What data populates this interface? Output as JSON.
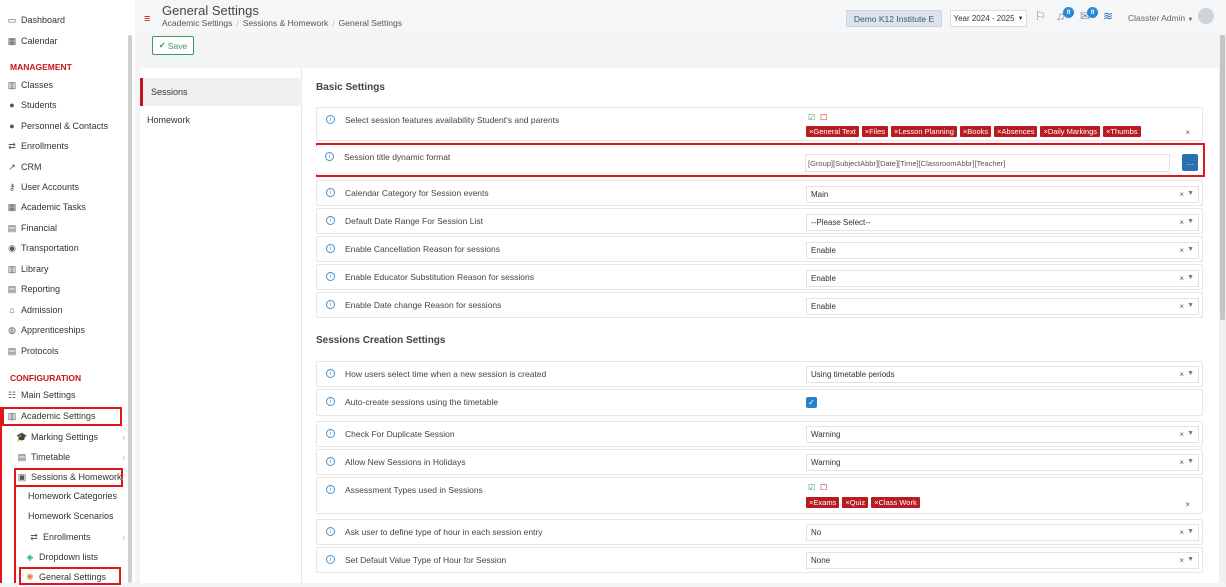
{
  "sidebar": {
    "items": [
      {
        "label": "Dashboard",
        "icon": "monitor-icon"
      },
      {
        "label": "Calendar",
        "icon": "calendar-icon"
      }
    ],
    "management_heading": "MANAGEMENT",
    "management": [
      {
        "label": "Classes",
        "icon": "classes-icon"
      },
      {
        "label": "Students",
        "icon": "students-icon"
      },
      {
        "label": "Personnel & Contacts",
        "icon": "person-icon"
      },
      {
        "label": "Enrollments",
        "icon": "exchange-icon"
      },
      {
        "label": "CRM",
        "icon": "crm-icon"
      },
      {
        "label": "User Accounts",
        "icon": "key-icon"
      },
      {
        "label": "Academic Tasks",
        "icon": "grid-icon"
      },
      {
        "label": "Financial",
        "icon": "money-icon"
      },
      {
        "label": "Transportation",
        "icon": "bus-icon"
      },
      {
        "label": "Library",
        "icon": "books-icon"
      },
      {
        "label": "Reporting",
        "icon": "report-icon"
      },
      {
        "label": "Admission",
        "icon": "bank-icon"
      },
      {
        "label": "Apprenticeships",
        "icon": "apprentice-icon"
      },
      {
        "label": "Protocols",
        "icon": "protocol-icon"
      }
    ],
    "configuration_heading": "CONFIGURATION",
    "configuration": [
      {
        "label": "Main Settings",
        "icon": "sliders-icon"
      },
      {
        "label": "Academic Settings",
        "icon": "classes-icon"
      }
    ],
    "academic_sub": [
      {
        "label": "Marking Settings",
        "icon": "graduation-icon"
      },
      {
        "label": "Timetable",
        "icon": "timetable-icon"
      },
      {
        "label": "Sessions & Homework",
        "icon": "sessions-icon"
      }
    ],
    "sessions_sub": [
      {
        "label": "Homework Categories"
      },
      {
        "label": "Homework Scenarios"
      },
      {
        "label": "Enrollments",
        "icon": "exchange-icon"
      },
      {
        "label": "Dropdown lists",
        "icon": "layers-icon"
      },
      {
        "label": "General Settings",
        "icon": "cog-icon"
      }
    ]
  },
  "header": {
    "title": "General Settings",
    "breadcrumb": [
      "Academic Settings",
      "Sessions & Homework",
      "General Settings"
    ],
    "institute": "Demo K12 Institute E",
    "year": "Year 2024 - 2025",
    "notif_count": "0",
    "msg_count": "0",
    "user": "Classter Admin"
  },
  "toolbar": {
    "save_label": "Save"
  },
  "leftnav": {
    "items": [
      "Sessions",
      "Homework"
    ]
  },
  "basic": {
    "title": "Basic Settings",
    "features_label": "Select session features availability Student's and parents",
    "features_tags": [
      "General Text",
      "Files",
      "Lesson Planning",
      "Books",
      "Absences",
      "Daily Markings",
      "Thumbs"
    ],
    "title_format_label": "Session title dynamic format",
    "title_format_value": "[Group][SubjectAbbr][Date][Time][ClassroomAbbr][Teacher]",
    "dots": "...",
    "rows": [
      {
        "label": "Calendar Category for Session events",
        "value": "Main"
      },
      {
        "label": "Default Date Range For Session List",
        "value": "--Please Select--"
      },
      {
        "label": "Enable Cancellation Reason for sessions",
        "value": "Enable"
      },
      {
        "label": "Enable Educator Substitution Reason for sessions",
        "value": "Enable"
      },
      {
        "label": "Enable Date change Reason for sessions",
        "value": "Enable"
      }
    ]
  },
  "creation": {
    "title": "Sessions Creation Settings",
    "time_label": "How users select time when a new session is created",
    "time_value": "Using timetable periods",
    "auto_label": "Auto-create sessions using the timetable",
    "dup_label": "Check For Duplicate Session",
    "dup_value": "Warning",
    "holiday_label": "Allow New Sessions in Holidays",
    "holiday_value": "Warning",
    "assess_label": "Assessment Types used in Sessions",
    "assess_tags": [
      "Exams",
      "Quiz",
      "Class Work"
    ],
    "hour_label": "Ask user to define type of hour in each session entry",
    "hour_value": "No",
    "default_hour_label": "Set Default Value Type of Hour for Session",
    "default_hour_value": "None"
  },
  "colors": {
    "accent": "#c0161c",
    "highlight_box": "#e0161c",
    "primary": "#2a6fb0"
  }
}
